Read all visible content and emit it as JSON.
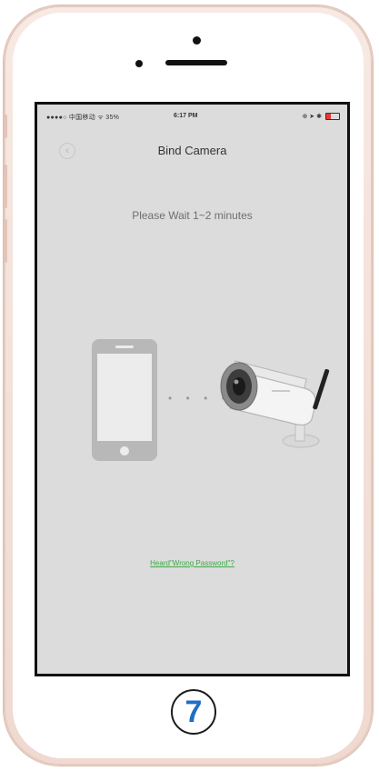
{
  "status_bar": {
    "carrier": "●●●●○ 中国移动 ᯤ 35%",
    "time": "6:17 PM",
    "icons": "⊕ ➤ ✱"
  },
  "nav": {
    "back_icon": "‹",
    "title": "Bind Camera"
  },
  "message": "Please Wait 1~2 minutes",
  "connection_dots": "• • • •",
  "link_text": "Heard\"Wrong Password\"?",
  "step_number": "7",
  "colors": {
    "screen_bg": "#dcdcdc",
    "link_green": "#3faa48",
    "step_blue": "#1e6ec9",
    "phone_frame": "#f3e1da"
  }
}
